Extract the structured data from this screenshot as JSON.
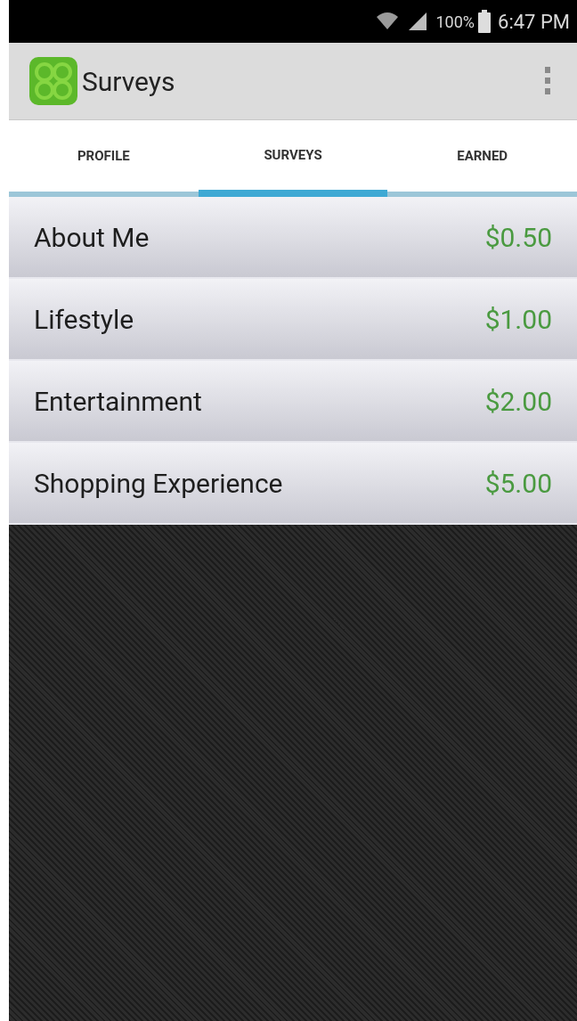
{
  "status_bar": {
    "battery": "100%",
    "time": "6:47 PM"
  },
  "app_bar": {
    "title": "Surveys"
  },
  "tabs": [
    {
      "label": "PROFILE",
      "selected": false
    },
    {
      "label": "SURVEYS",
      "selected": true
    },
    {
      "label": "EARNED",
      "selected": false
    }
  ],
  "surveys": [
    {
      "name": "About Me",
      "reward": "$0.50"
    },
    {
      "name": "Lifestyle",
      "reward": "$1.00"
    },
    {
      "name": "Entertainment",
      "reward": "$2.00"
    },
    {
      "name": "Shopping Experience",
      "reward": "$5.00"
    }
  ]
}
